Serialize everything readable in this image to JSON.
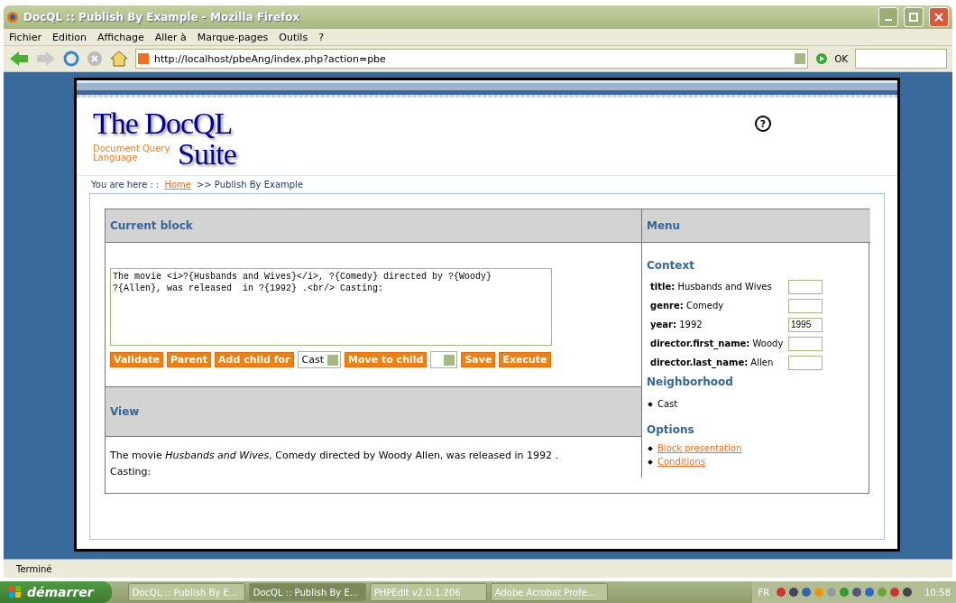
{
  "window": {
    "title": "DocQL :: Publish By Example - Mozilla Firefox"
  },
  "menu": [
    "Fichier",
    "Edition",
    "Affichage",
    "Aller à",
    "Marque-pages",
    "Outils",
    "?"
  ],
  "toolbar": {
    "url": "http://localhost/pbeAng/index.php?action=pbe",
    "go_label": "OK"
  },
  "page": {
    "logo_title": "The DocQL",
    "logo_suite": "Suite",
    "logo_subtitle": "Document Query Language",
    "help_label": "?",
    "breadcrumb": {
      "prefix": "You are here : :",
      "link": "Home",
      "current": ">> Publish By Example"
    },
    "current_block": {
      "heading": "Current block",
      "code": "The movie <i>?{Husbands and Wives}</i>, ?{Comedy} directed by ?{Woody}\n?{Allen}, was released  in ?{1992} .<br/> Casting:",
      "controls": [
        {
          "kind": "button",
          "label": "Validate"
        },
        {
          "kind": "button",
          "label": "Parent"
        },
        {
          "kind": "button",
          "label": "Add child for"
        },
        {
          "kind": "select",
          "value": "Cast"
        },
        {
          "kind": "button",
          "label": "Move to child"
        },
        {
          "kind": "select"
        },
        {
          "kind": "button",
          "label": "Save"
        },
        {
          "kind": "button",
          "label": "Execute"
        }
      ]
    },
    "view": {
      "heading": "View",
      "before": "The movie ",
      "italic": "Husbands and Wives",
      "after": ", Comedy directed by Woody Allen, was released in 1992 .",
      "line2": "Casting:"
    },
    "menu_panel": {
      "heading": "Menu",
      "context_heading": "Context",
      "context": [
        {
          "key": "title:",
          "value": "Husbands and Wives"
        },
        {
          "key": "genre:",
          "value": "Comedy"
        },
        {
          "key": "year:",
          "value": "1992",
          "input": "1995"
        },
        {
          "key": "director.first_name:",
          "value": "Woody"
        },
        {
          "key": "director.last_name:",
          "value": "Allen"
        }
      ],
      "neighborhood_heading": "Neighborhood",
      "neighborhood": [
        "Cast"
      ],
      "options_heading": "Options",
      "options": [
        "Block presentation",
        "Conditions"
      ]
    }
  },
  "status_bar": "Terminé",
  "taskbar": {
    "start": "démarrer",
    "tasks": [
      {
        "label": "DocQL :: Publish By E...",
        "selected": false
      },
      {
        "label": "DocQL :: Publish By E...",
        "selected": true
      },
      {
        "label": "PHPEdit v2.0.1.206",
        "selected": false
      },
      {
        "label": "Adobe Acrobat Profe...",
        "selected": false
      }
    ],
    "language": "FR",
    "clock": "10:58"
  }
}
